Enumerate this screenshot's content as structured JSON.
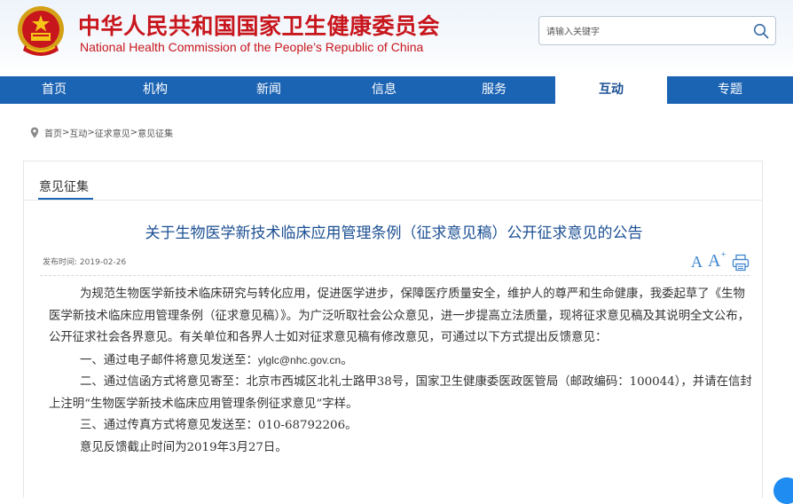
{
  "header": {
    "title_cn": "中华人民共和国国家卫生健康委员会",
    "title_en": "National Health Commission of the People’s Republic of China",
    "search_placeholder": "请输入关键字",
    "brand_color": "#c8161d"
  },
  "nav": {
    "items": [
      {
        "label": "首页"
      },
      {
        "label": "机构"
      },
      {
        "label": "新闻"
      },
      {
        "label": "信息"
      },
      {
        "label": "服务"
      },
      {
        "label": "互动"
      },
      {
        "label": "专题"
      }
    ],
    "active": "互动",
    "bar_color": "#1b63b3"
  },
  "breadcrumb": {
    "items": [
      "首页",
      "互动",
      "征求意见",
      "意见征集"
    ],
    "separator": ">"
  },
  "panel": {
    "tab_label": "意见征集"
  },
  "article": {
    "title": "关于生物医学新技术临床应用管理条例（征求意见稿）公开征求意见的公告",
    "pubdate_label": "发布时间:",
    "pubdate": "2019-02-26",
    "font_small_label": "A",
    "font_large_label": "A",
    "font_large_sup": "+",
    "paragraphs": {
      "intro": "为规范生物医学新技术临床研究与转化应用，促进医学进步，保障医疗质量安全，维护人的尊严和生命健康，我委起草了《生物医学新技术临床应用管理条例（征求意见稿）》。为广泛听取社会公众意见，进一步提高立法质量，现将征求意见稿及其说明全文公布，公开征求社会各界意见。有关单位和各界人士如对征求意见稿有修改意见，可通过以下方式提出反馈意见：",
      "item1_prefix": "一、通过电子邮件将意见发送至：",
      "item1_email": "ylglc@nhc.gov.cn",
      "item1_suffix": "。",
      "item2": "二、通过信函方式将意见寄至：北京市西城区北礼士路甲38号，国家卫生健康委医政医管局（邮政编码：100044），并请在信封上注明“生物医学新技术临床应用管理条例征求意见”字样。",
      "item3": "三、通过传真方式将意见发送至：010-68792206。",
      "deadline": "意见反馈截止时间为2019年3月27日。"
    }
  }
}
